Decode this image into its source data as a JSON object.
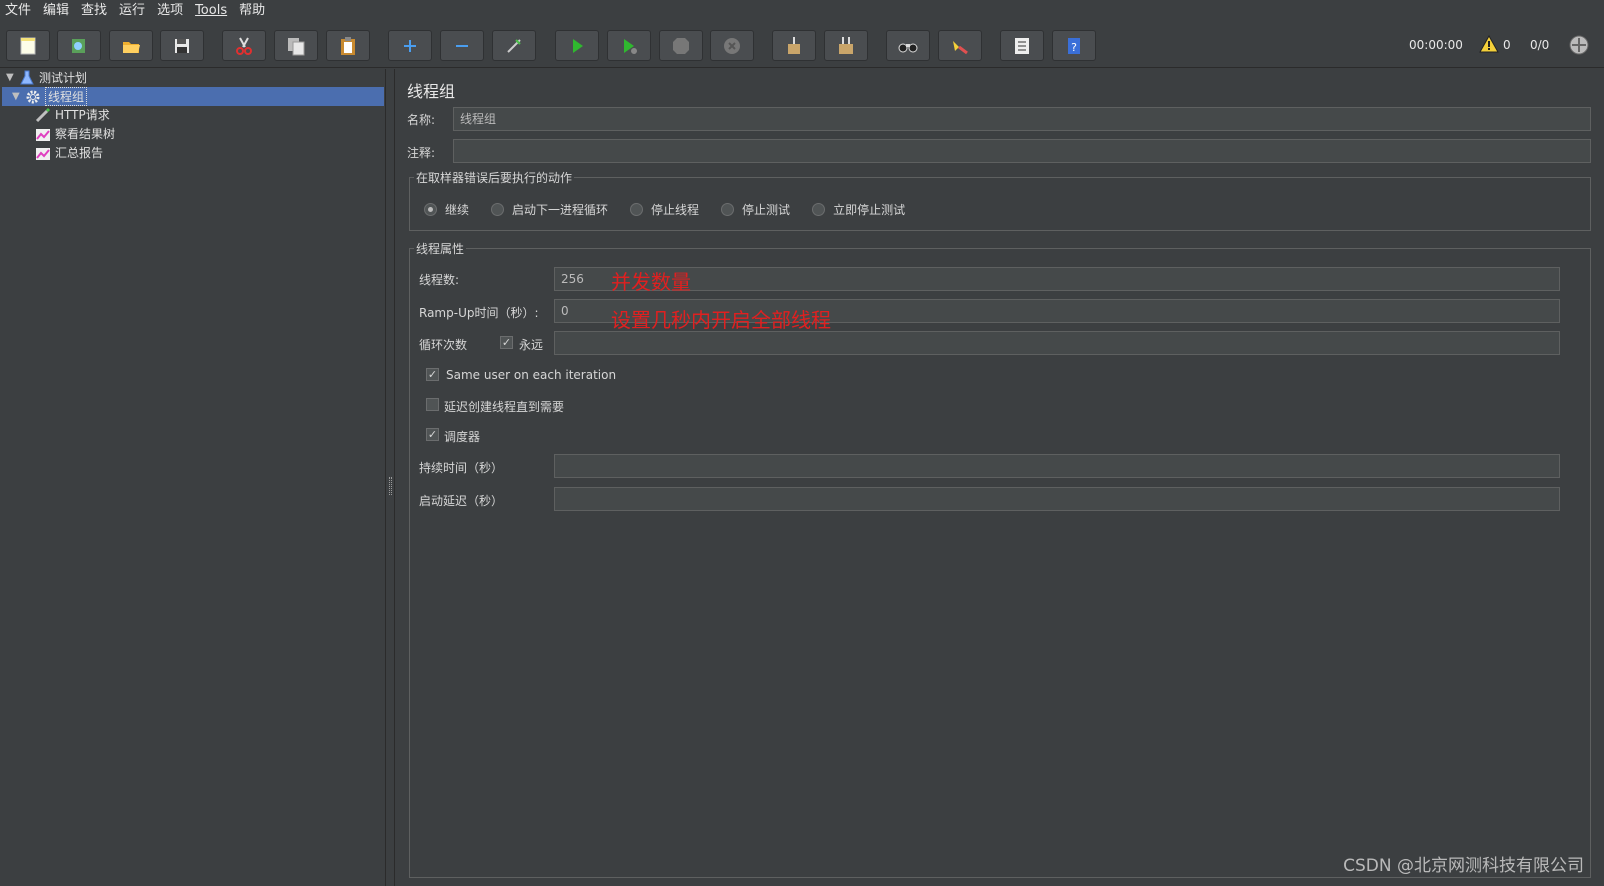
{
  "menu": [
    "文件",
    "编辑",
    "查找",
    "运行",
    "选项",
    "Tools",
    "帮助"
  ],
  "toolbar": {
    "buttons": [
      "new",
      "templates",
      "open",
      "save",
      "cut",
      "copy",
      "paste",
      "expand",
      "collapse",
      "toggle",
      "start",
      "start-no-pauses",
      "stop",
      "shutdown",
      "clear",
      "clear-all",
      "search",
      "reset-search",
      "function-helper",
      "help"
    ],
    "timer": "00:00:00",
    "warning_count": "0",
    "threads": "0/0"
  },
  "tree": {
    "items": [
      {
        "label": "测试计划"
      },
      {
        "label": "线程组"
      },
      {
        "label": "HTTP请求"
      },
      {
        "label": "察看结果树"
      },
      {
        "label": "汇总报告"
      }
    ]
  },
  "panel": {
    "title": "线程组",
    "name_label": "名称:",
    "name_value": "线程组",
    "comment_label": "注释:",
    "comment_value": "",
    "error_action": {
      "legend": "在取样器错误后要执行的动作",
      "options": [
        "继续",
        "启动下一进程循环",
        "停止线程",
        "停止测试",
        "立即停止测试"
      ],
      "selected": "继续"
    },
    "thread_props": {
      "legend": "线程属性",
      "threads_label": "线程数:",
      "threads_value": "256",
      "rampup_label": "Ramp-Up时间（秒）:",
      "rampup_value": "0",
      "loop_label": "循环次数",
      "forever_label": "永远",
      "forever_checked": true,
      "loop_value": "",
      "same_user_label": "Same user on each iteration",
      "same_user_checked": true,
      "delay_label": "延迟创建线程直到需要",
      "delay_checked": false,
      "scheduler_label": "调度器",
      "scheduler_checked": true,
      "duration_label": "持续时间（秒）",
      "duration_value": "",
      "startup_delay_label": "启动延迟（秒）",
      "startup_delay_value": ""
    }
  },
  "annotations": {
    "threads_note": "并发数量",
    "rampup_note": "设置几秒内开启全部线程"
  },
  "watermark": "CSDN @北京网测科技有限公司",
  "colors": {
    "background": "#3c3f41",
    "selection": "#4b6eaf",
    "annotation": "#e02020"
  }
}
